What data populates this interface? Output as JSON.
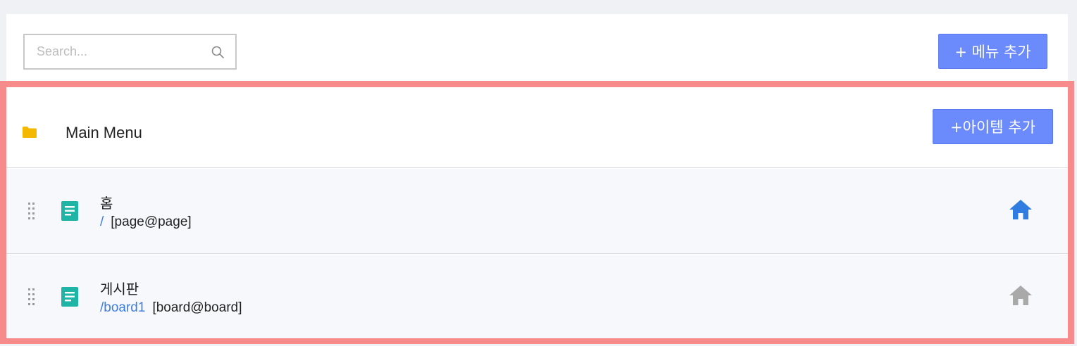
{
  "toolbar": {
    "search_placeholder": "Search...",
    "add_menu_label": "+ 메뉴 추가"
  },
  "menu": {
    "title": "Main Menu",
    "add_item_label": "+아이템 추가",
    "items": [
      {
        "name": "홈",
        "path": "/",
        "type": "[page@page]",
        "is_home": true
      },
      {
        "name": "게시판",
        "path": "/board1",
        "type": "[board@board]",
        "is_home": false
      }
    ]
  },
  "colors": {
    "accent": "#6b8afb",
    "highlight_border": "#f78b8b",
    "folder": "#f5b800",
    "doc_icon": "#1eb5a6",
    "home_active": "#2f7de1",
    "home_inactive": "#a9a9a9",
    "link": "#3d7de0"
  }
}
